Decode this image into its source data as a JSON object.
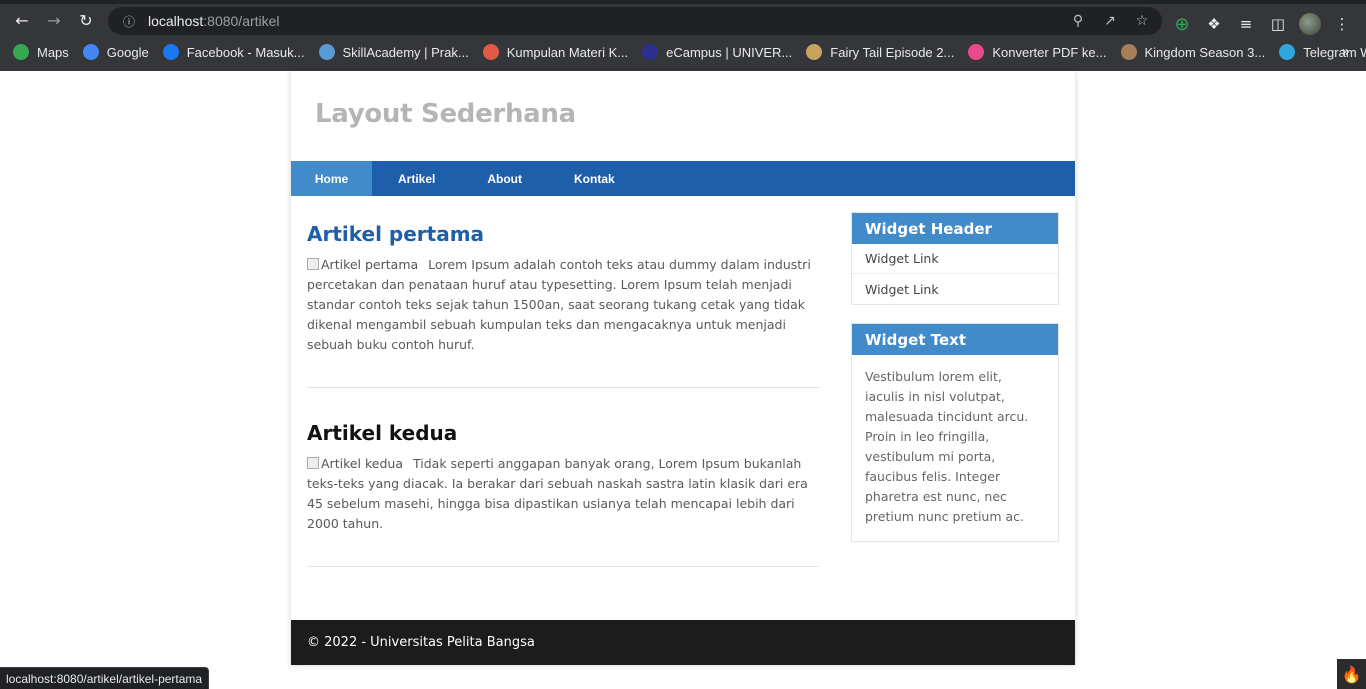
{
  "browser": {
    "url_host": "localhost",
    "url_rest": ":8080/artikel",
    "bookmarks": [
      {
        "label": "Maps",
        "icon": "maps-icon",
        "color": "#34a853"
      },
      {
        "label": "Google",
        "icon": "google-icon",
        "color": "#4285f4"
      },
      {
        "label": "Facebook - Masuk...",
        "icon": "facebook-icon",
        "color": "#1877f2"
      },
      {
        "label": "SkillAcademy | Prak...",
        "icon": "skillacademy-icon",
        "color": "#5b9bd5"
      },
      {
        "label": "Kumpulan Materi K...",
        "icon": "kumpulan-icon",
        "color": "#e05a47"
      },
      {
        "label": "eCampus | UNIVER...",
        "icon": "ecampus-icon",
        "color": "#2d2f8f"
      },
      {
        "label": "Fairy Tail Episode 2...",
        "icon": "fairytail-icon",
        "color": "#c9a25d"
      },
      {
        "label": "Konverter PDF ke...",
        "icon": "pdf-icon",
        "color": "#e94b8a"
      },
      {
        "label": "Kingdom Season 3...",
        "icon": "kingdom-icon",
        "color": "#a57e5a"
      },
      {
        "label": "Telegram Web",
        "icon": "telegram-icon",
        "color": "#2ea6e0"
      }
    ],
    "status_url": "localhost:8080/artikel/artikel-pertama"
  },
  "site": {
    "title": "Layout Sederhana",
    "nav": [
      "Home",
      "Artikel",
      "About",
      "Kontak"
    ],
    "articles": [
      {
        "title": "Artikel pertama",
        "img_alt": "Artikel pertama",
        "body": "Lorem Ipsum adalah contoh teks atau dummy dalam industri percetakan dan penataan huruf atau typesetting. Lorem Ipsum telah menjadi standar contoh teks sejak tahun 1500an, saat seorang tukang cetak yang tidak dikenal mengambil sebuah kumpulan teks dan mengacaknya untuk menjadi sebuah buku contoh huruf."
      },
      {
        "title": "Artikel kedua",
        "img_alt": "Artikel kedua",
        "body": "Tidak seperti anggapan banyak orang, Lorem Ipsum bukanlah teks-teks yang diacak. Ia berakar dari sebuah naskah sastra latin klasik dari era 45 sebelum masehi, hingga bisa dipastikan usianya telah mencapai lebih dari 2000 tahun."
      }
    ],
    "widgets": {
      "header_title": "Widget Header",
      "links": [
        "Widget Link",
        "Widget Link"
      ],
      "text_title": "Widget Text",
      "text_body": "Vestibulum lorem elit, iaculis in nisl volutpat, malesuada tincidunt arcu. Proin in leo fringilla, vestibulum mi porta, faucibus felis. Integer pharetra est nunc, nec pretium nunc pretium ac."
    },
    "footer": "© 2022 - Universitas Pelita Bangsa"
  },
  "colors": {
    "nav_bg": "#1f5faa",
    "nav_active": "#428bca",
    "widget_header": "#428bca",
    "footer_bg": "#1c1c1c"
  }
}
